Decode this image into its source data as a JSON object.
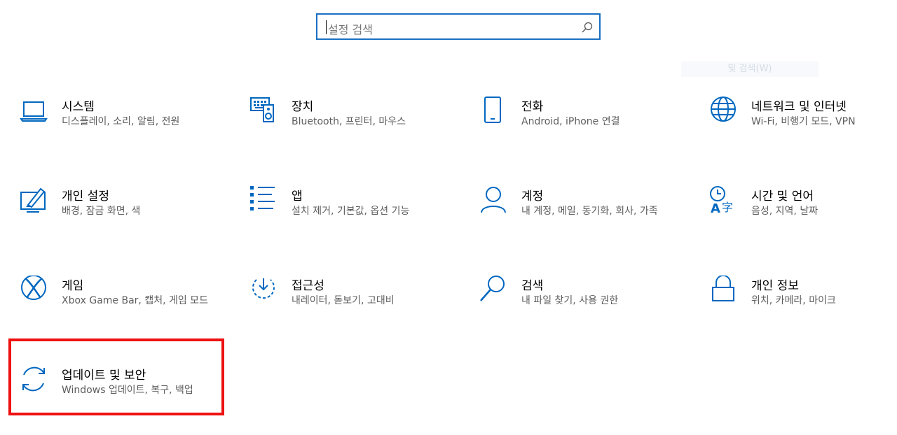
{
  "search": {
    "placeholder": "설정 검색"
  },
  "ghost_label": "및 검색(W)",
  "tiles": [
    {
      "title": "시스템",
      "desc": "디스플레이, 소리, 알림, 전원",
      "icon": "laptop-icon"
    },
    {
      "title": "장치",
      "desc": "Bluetooth, 프린터, 마우스",
      "icon": "devices-icon"
    },
    {
      "title": "전화",
      "desc": "Android, iPhone 연결",
      "icon": "phone-icon"
    },
    {
      "title": "네트워크 및 인터넷",
      "desc": "Wi-Fi, 비행기 모드, VPN",
      "icon": "globe-icon"
    },
    {
      "title": "개인 설정",
      "desc": "배경, 잠금 화면, 색",
      "icon": "personalization-icon"
    },
    {
      "title": "앱",
      "desc": "설치 제거, 기본값, 옵션 기능",
      "icon": "apps-list-icon"
    },
    {
      "title": "계정",
      "desc": "내 계정, 메일, 동기화, 회사, 가족",
      "icon": "person-icon"
    },
    {
      "title": "시간 및 언어",
      "desc": "음성, 지역, 날짜",
      "icon": "time-language-icon"
    },
    {
      "title": "게임",
      "desc": "Xbox Game Bar, 캡처, 게임 모드",
      "icon": "xbox-icon"
    },
    {
      "title": "접근성",
      "desc": "내레이터, 돋보기, 고대비",
      "icon": "ease-of-access-icon"
    },
    {
      "title": "검색",
      "desc": "내 파일 찾기, 사용 권한",
      "icon": "search-icon"
    },
    {
      "title": "개인 정보",
      "desc": "위치, 카메라, 마이크",
      "icon": "lock-icon"
    },
    {
      "title": "업데이트 및 보안",
      "desc": "Windows 업데이트, 복구, 백업",
      "icon": "sync-icon"
    }
  ],
  "colors": {
    "accent": "#0067c0",
    "highlight": "#ee1111"
  }
}
